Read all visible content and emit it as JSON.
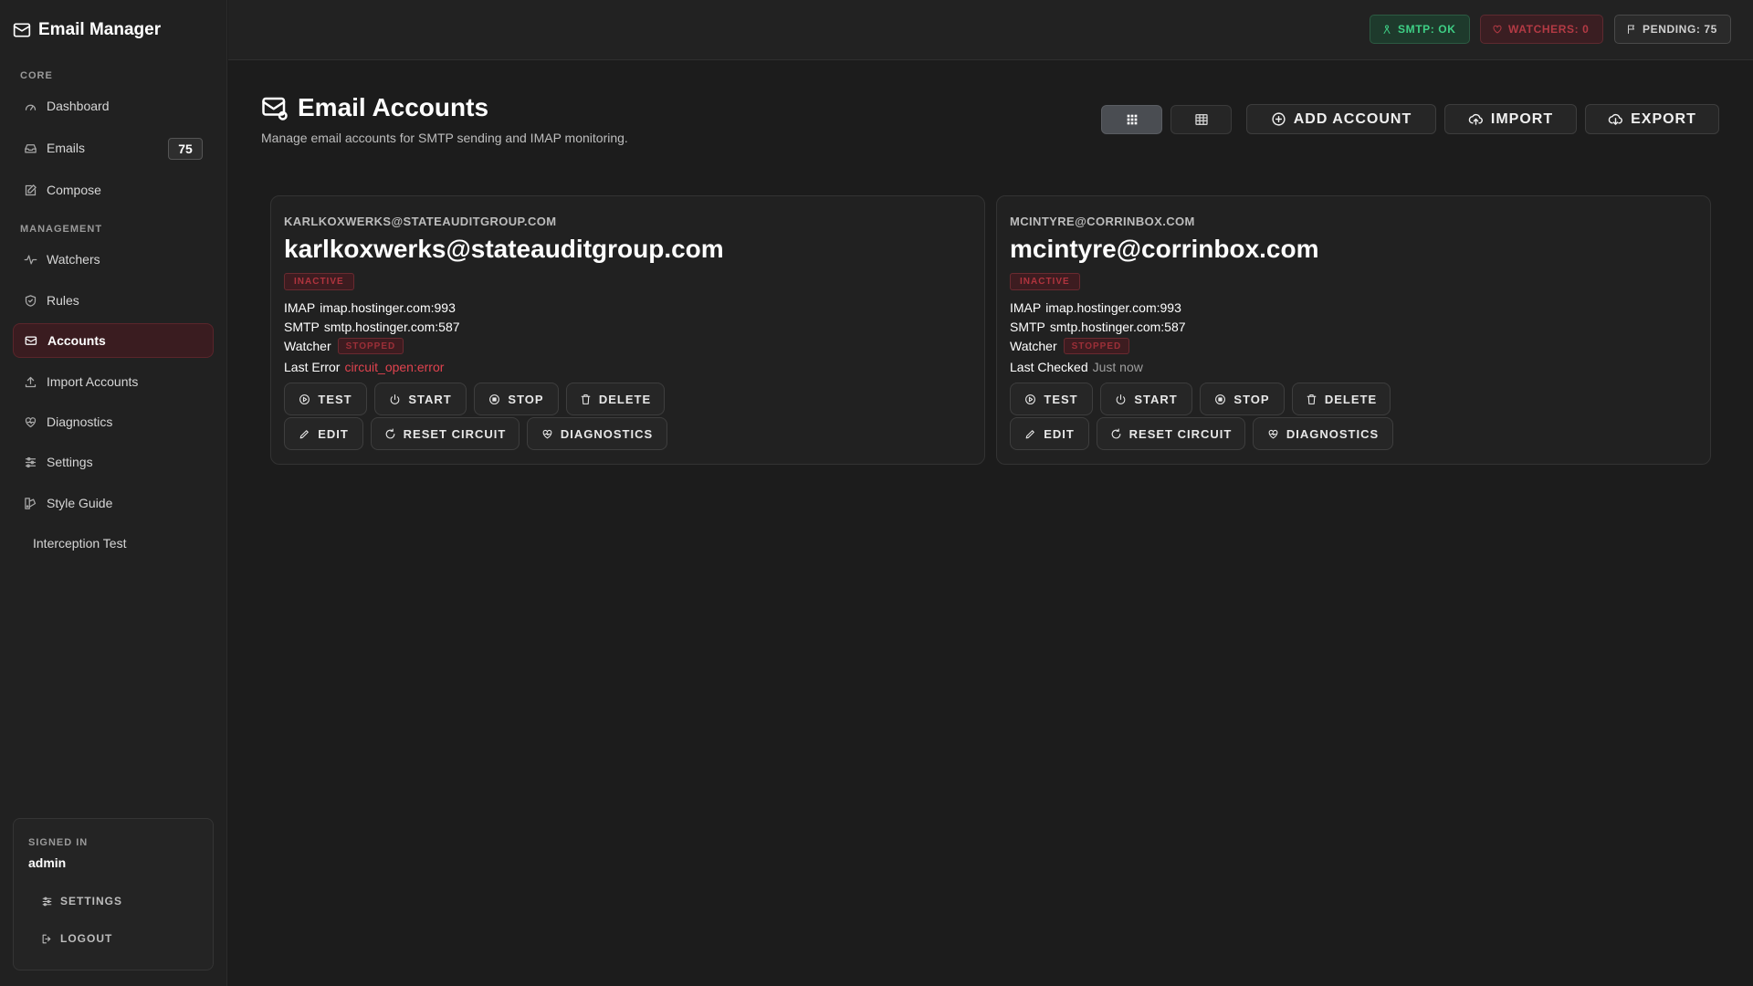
{
  "app": {
    "title": "Email Manager"
  },
  "sidebar": {
    "sections": {
      "core": "CORE",
      "management": "MANAGEMENT"
    },
    "items": [
      {
        "label": "Dashboard",
        "icon": "gauge-icon"
      },
      {
        "label": "Emails",
        "icon": "inbox-icon",
        "badge": "75"
      },
      {
        "label": "Compose",
        "icon": "pencil-square-icon"
      },
      {
        "label": "Watchers",
        "icon": "activity-icon"
      },
      {
        "label": "Rules",
        "icon": "shield-icon"
      },
      {
        "label": "Accounts",
        "icon": "envelope-at-icon",
        "active": true
      },
      {
        "label": "Import Accounts",
        "icon": "upload-icon"
      },
      {
        "label": "Diagnostics",
        "icon": "heart-pulse-icon"
      },
      {
        "label": "Settings",
        "icon": "sliders-icon"
      },
      {
        "label": "Style Guide",
        "icon": "palette-icon"
      },
      {
        "label": "Interception Test"
      }
    ],
    "user": {
      "signed_in_label": "SIGNED IN",
      "name": "admin",
      "settings_label": "SETTINGS",
      "logout_label": "LOGOUT"
    }
  },
  "topbar": {
    "smtp": "SMTP: OK",
    "watchers": "WATCHERS: 0",
    "pending": "PENDING: 75",
    "colors": {
      "ok": "#3ecf85",
      "error": "#b33a44",
      "neutral": "#d0d0d0"
    }
  },
  "page": {
    "title": "Email Accounts",
    "subtitle": "Manage email accounts for SMTP sending and IMAP monitoring.",
    "actions": {
      "add": "ADD ACCOUNT",
      "import": "IMPORT",
      "export": "EXPORT"
    },
    "view_mode": "grid"
  },
  "accounts": [
    {
      "kicker": "KARLKOXWERKS@STATEAUDITGROUP.COM",
      "email": "karlkoxwerks@stateauditgroup.com",
      "status": "INACTIVE",
      "imap_label": "IMAP",
      "imap": "imap.hostinger.com:993",
      "smtp_label": "SMTP",
      "smtp": "smtp.hostinger.com:587",
      "watcher_label": "Watcher",
      "watcher_status": "STOPPED",
      "last_label": "Last Error",
      "last_value": "circuit_open:error"
    },
    {
      "kicker": "MCINTYRE@CORRINBOX.COM",
      "email": "mcintyre@corrinbox.com",
      "status": "INACTIVE",
      "imap_label": "IMAP",
      "imap": "imap.hostinger.com:993",
      "smtp_label": "SMTP",
      "smtp": "smtp.hostinger.com:587",
      "watcher_label": "Watcher",
      "watcher_status": "STOPPED",
      "last_label": "Last Checked",
      "last_value": "Just now"
    }
  ],
  "card_actions": {
    "test": "TEST",
    "start": "START",
    "stop": "STOP",
    "delete": "DELETE",
    "edit": "EDIT",
    "reset_circuit": "RESET CIRCUIT",
    "diagnostics": "DIAGNOSTICS"
  },
  "accent_color": "#5a252b"
}
